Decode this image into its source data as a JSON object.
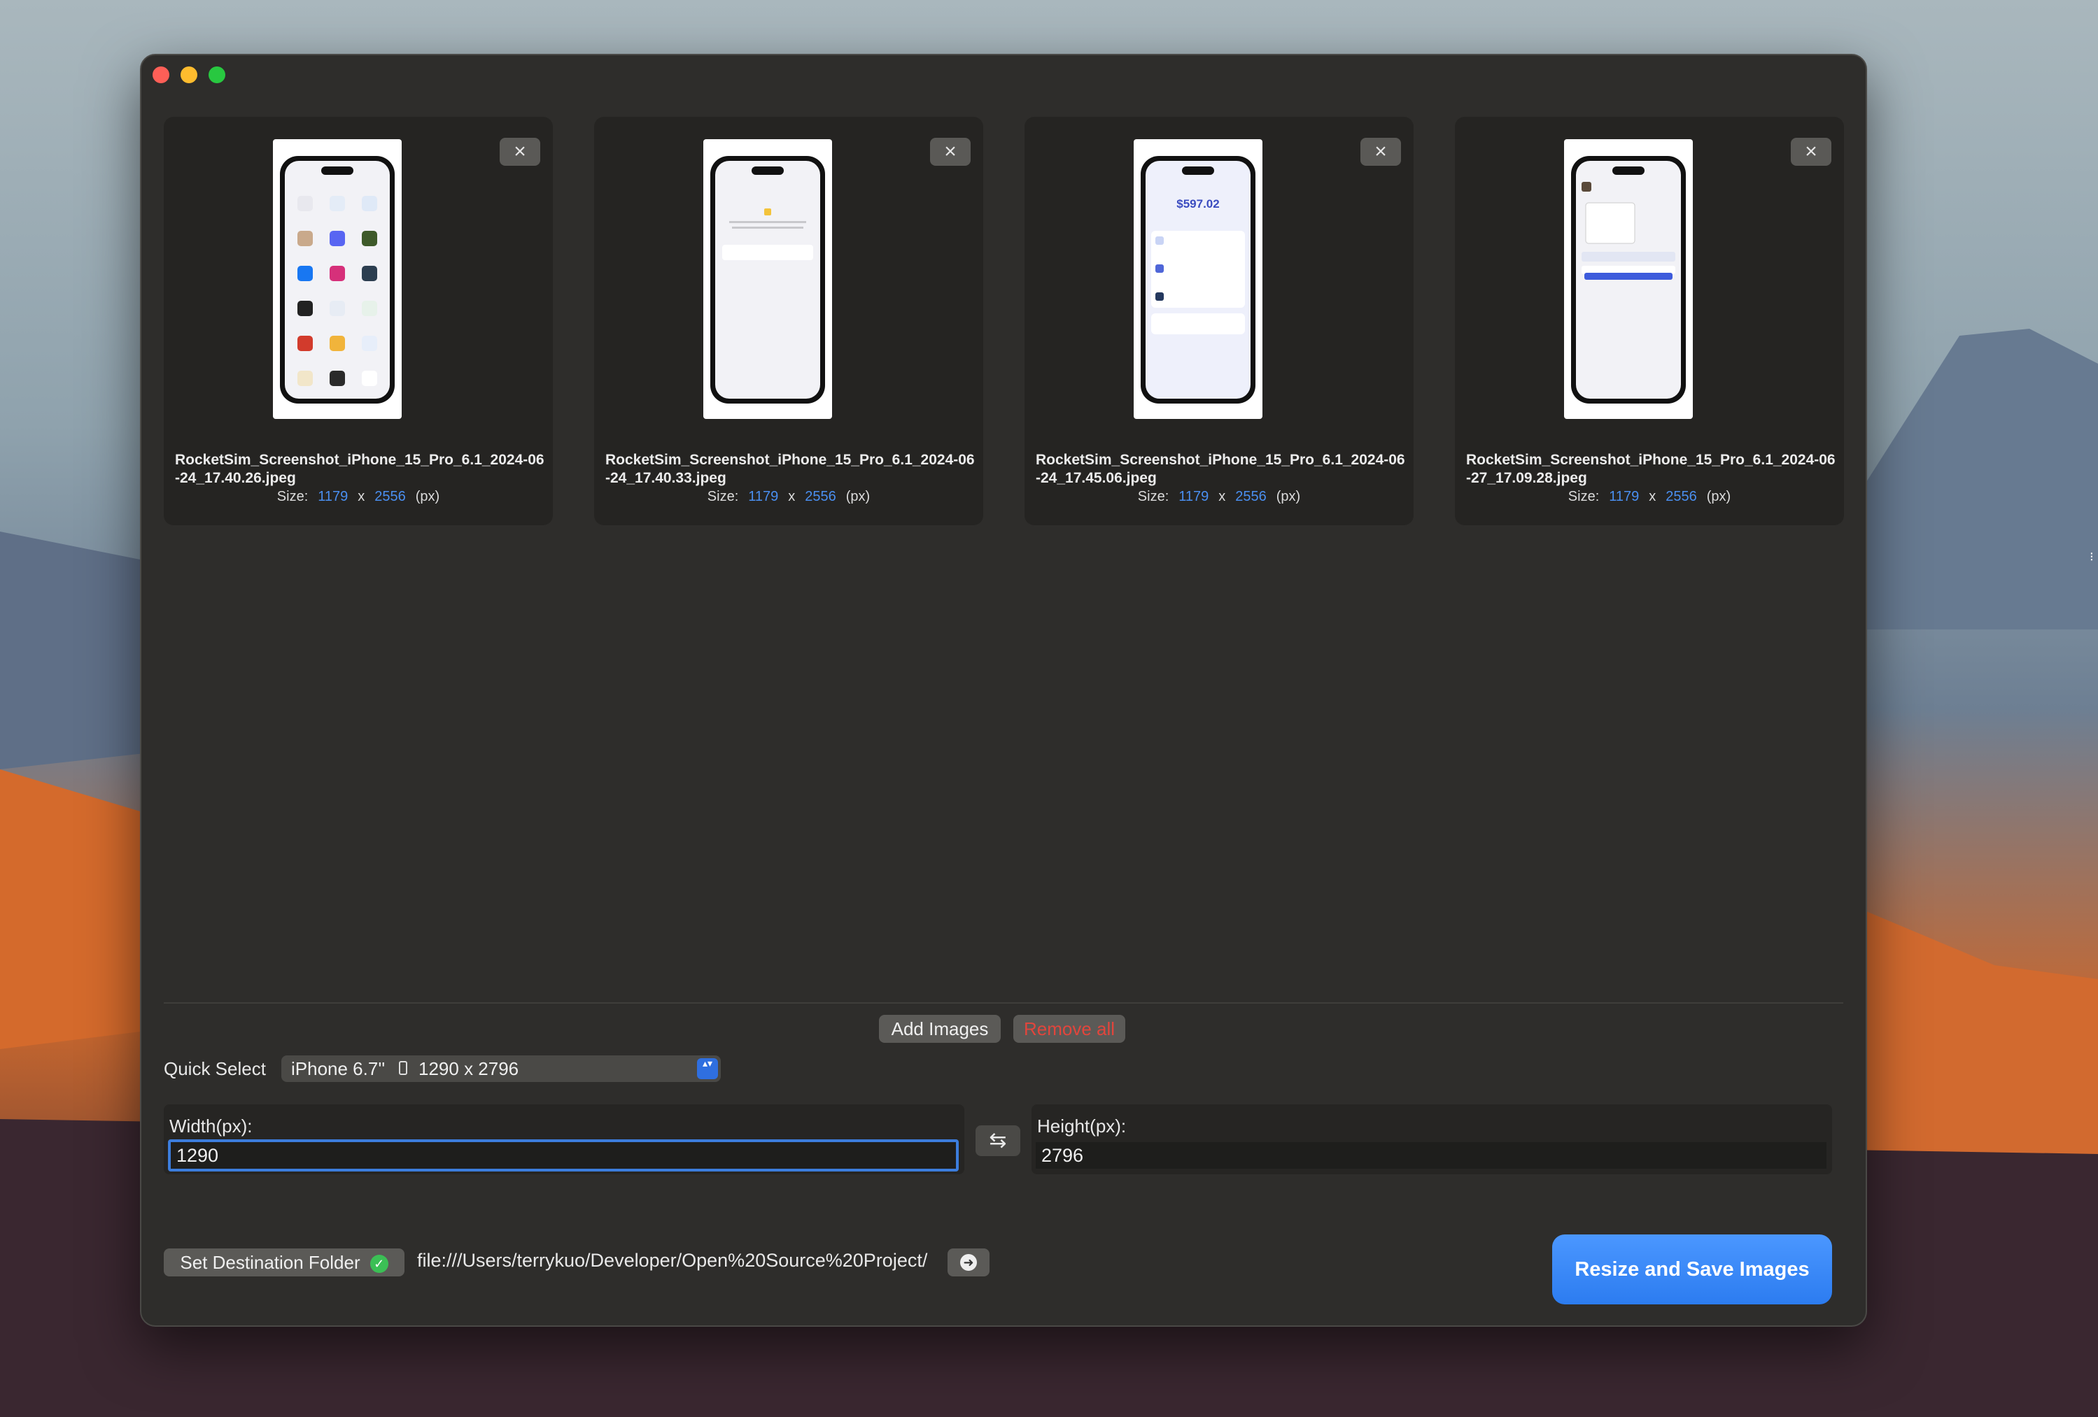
{
  "window": {
    "traffic_lights": [
      "close",
      "minimize",
      "zoom"
    ]
  },
  "images": [
    {
      "filename": "RocketSim_Screenshot_iPhone_15_Pro_6.1_2024-06-24_17.40.26.jpeg",
      "size_label": "Size:",
      "width": "1179",
      "sep": "x",
      "height": "2556",
      "unit": "(px)",
      "remove_icon": "×"
    },
    {
      "filename": "RocketSim_Screenshot_iPhone_15_Pro_6.1_2024-06-24_17.40.33.jpeg",
      "size_label": "Size:",
      "width": "1179",
      "sep": "x",
      "height": "2556",
      "unit": "(px)",
      "remove_icon": "×"
    },
    {
      "filename": "RocketSim_Screenshot_iPhone_15_Pro_6.1_2024-06-24_17.45.06.jpeg",
      "size_label": "Size:",
      "width": "1179",
      "sep": "x",
      "height": "2556",
      "unit": "(px)",
      "remove_icon": "×",
      "amount": "$597.02"
    },
    {
      "filename": "RocketSim_Screenshot_iPhone_15_Pro_6.1_2024-06-27_17.09.28.jpeg",
      "size_label": "Size:",
      "width": "1179",
      "sep": "x",
      "height": "2556",
      "unit": "(px)",
      "remove_icon": "×"
    }
  ],
  "actions": {
    "add_images": "Add Images",
    "remove_all": "Remove all"
  },
  "quick_select": {
    "label": "Quick Select",
    "value_device": "iPhone 6.7''",
    "value_size": "1290 x 2796",
    "arrows": "▴▾"
  },
  "dimensions": {
    "width_label": "Width(px):",
    "width_value": "1290",
    "height_label": "Height(px):",
    "height_value": "2796",
    "swap_icon": "⇆"
  },
  "destination": {
    "button_label": "Set Destination Folder",
    "check_icon": "✓",
    "path": "file:///Users/terrykuo/Developer/Open%20Source%20Project/",
    "go_icon": "➜"
  },
  "primary_action": "Resize and Save Images",
  "colors": {
    "accent": "#2f7cf0",
    "destructive": "#e2453c",
    "success": "#3bbf55"
  }
}
